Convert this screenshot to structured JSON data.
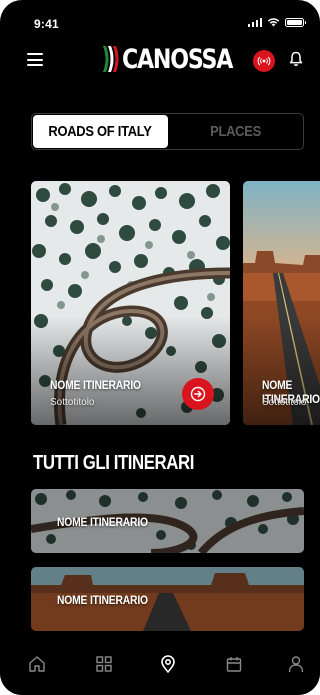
{
  "status_bar": {
    "time": "9:41"
  },
  "header": {
    "menu_icon": "hamburger-menu-icon",
    "logo_text": "CANOSSA",
    "live_icon": "live-broadcast-icon",
    "notification_icon": "bell-icon"
  },
  "segment": {
    "tabs": [
      {
        "label": "ROADS OF ITALY",
        "selected": true
      },
      {
        "label": "PLACES",
        "selected": false
      }
    ]
  },
  "featured": [
    {
      "title": "NOME ITINERARIO",
      "subtitle": "Sottotitolo",
      "action_icon": "arrow-right-icon"
    },
    {
      "title": "NOME ITINERARIO",
      "subtitle": "Sottotitolo"
    }
  ],
  "all_itineraries": {
    "heading": "TUTTI GLI ITINERARI",
    "items": [
      {
        "title": "NOME ITINERARIO"
      },
      {
        "title": "NOME ITINERARIO"
      }
    ]
  },
  "tabbar": {
    "items": [
      {
        "icon": "home-icon"
      },
      {
        "icon": "grid-icon"
      },
      {
        "icon": "map-pin-icon",
        "active": true
      },
      {
        "icon": "calendar-icon"
      },
      {
        "icon": "user-icon"
      }
    ]
  },
  "colors": {
    "accent": "#d9141e",
    "background": "#000000",
    "brand_green": "#1f8a3a"
  }
}
